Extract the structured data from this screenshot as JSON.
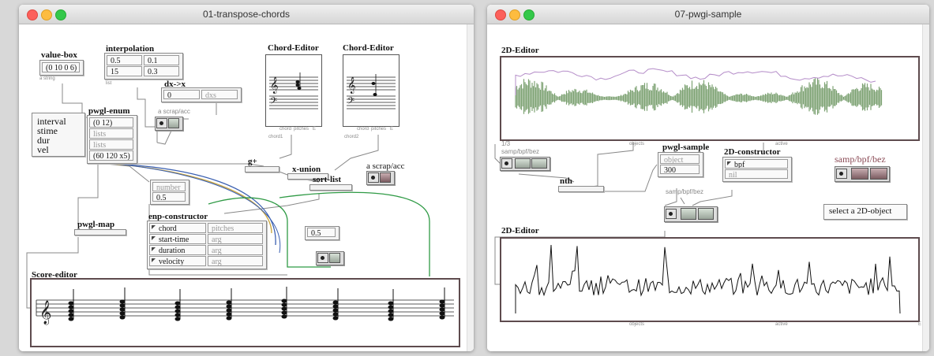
{
  "window1": {
    "title": "01-transpose-chords",
    "value_box": {
      "label": "value-box",
      "value": "(0 10 0 6)",
      "outlet": "a string"
    },
    "interpolation": {
      "label": "interpolation",
      "cells": [
        "0.5",
        "0.1",
        "15",
        "0.3"
      ],
      "outlet": "list"
    },
    "dx_x": {
      "label": "dx->x",
      "cells": [
        "0",
        "dxs"
      ]
    },
    "a_scrapbox_1": {
      "label": "a scrap/acc"
    },
    "pwgl_enum": {
      "label": "pwgl-enum",
      "cells": [
        "(0 12)",
        "lists",
        "lists",
        "(60 120 x5)"
      ]
    },
    "param_text": {
      "lines": [
        "interval",
        "stime",
        "dur",
        "vel"
      ]
    },
    "number_box": {
      "label": "number",
      "value": "0.5"
    },
    "chord_editor_1": {
      "label": "Chord-Editor",
      "outlets": [
        "chord",
        "pitches",
        "E"
      ],
      "bottom": "chord1"
    },
    "chord_editor_2": {
      "label": "Chord-Editor",
      "outlets": [
        "chord",
        "pitches",
        "E"
      ],
      "bottom": "chord2"
    },
    "g_plus": {
      "label": "g+"
    },
    "x_union": {
      "label": "x-union"
    },
    "sort_list": {
      "label": "sort-list"
    },
    "a_scrapbox_2": {
      "label": "a scrap/acc"
    },
    "pwgl_map": {
      "label": "pwgl-map"
    },
    "enp_constructor": {
      "label": "enp-constructor",
      "rows": [
        {
          "name": "chord",
          "arg": "pitches"
        },
        {
          "name": "start-time",
          "arg": "arg"
        },
        {
          "name": "duration",
          "arg": "arg"
        },
        {
          "name": "velocity",
          "arg": "arg"
        }
      ]
    },
    "value_05": {
      "value": "0.5"
    },
    "score_editor": {
      "label": "Score-editor"
    }
  },
  "window2": {
    "title": "07-pwgi-sample",
    "editor_top": {
      "label": "2D-Editor",
      "outlets": [
        "objects",
        "active"
      ],
      "corner": "1/3"
    },
    "samp_bpf_left": {
      "label": "samp/bpf/bez"
    },
    "nth": {
      "label": "nth"
    },
    "pwgl_sample": {
      "label": "pwgl-sample",
      "cells": [
        "object",
        "300"
      ]
    },
    "constructor_2d": {
      "label": "2D-constructor",
      "cells": [
        "bpf",
        "nil"
      ]
    },
    "samp_bpf_mid": {
      "label": "samp/bpf/bez"
    },
    "samp_bpf_right": {
      "label": "samp/bpf/bez"
    },
    "select_msg": "select a 2D-object",
    "editor_bottom": {
      "label": "2D-Editor",
      "outlets": [
        "objects",
        "active"
      ],
      "corner": "E"
    }
  },
  "colors": {
    "wave": "#7ea374",
    "env": "#b48cc8",
    "frame": "#5e4b4e",
    "wire_blue": "#3a5fb0",
    "wire_yellow": "#c9a43a",
    "wire_green": "#2f9a45",
    "wire_grey": "#888888"
  }
}
